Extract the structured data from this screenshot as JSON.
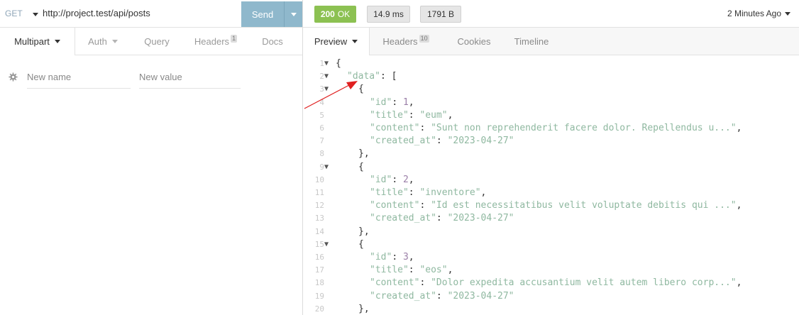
{
  "request": {
    "method": "GET",
    "url": "http://project.test/api/posts",
    "send_label": "Send",
    "tabs": [
      {
        "label": "Multipart",
        "active": true
      },
      {
        "label": "Auth"
      },
      {
        "label": "Query"
      },
      {
        "label": "Headers",
        "badge": "1"
      },
      {
        "label": "Docs"
      }
    ],
    "params": {
      "name_placeholder": "New name",
      "value_placeholder": "New value"
    }
  },
  "response": {
    "status_code": "200",
    "status_text": "OK",
    "time": "14.9 ms",
    "size": "1791 B",
    "history": "2 Minutes Ago",
    "tabs": [
      {
        "label": "Preview",
        "active": true
      },
      {
        "label": "Headers",
        "badge": "10"
      },
      {
        "label": "Cookies"
      },
      {
        "label": "Timeline"
      }
    ],
    "code_lines": [
      {
        "n": "1",
        "fold": true,
        "indent": 0,
        "html": "<span class='p'>{</span>"
      },
      {
        "n": "2",
        "fold": true,
        "indent": 1,
        "html": "<span class='k'>\"data\"</span><span class='p'>: [</span>"
      },
      {
        "n": "3",
        "fold": true,
        "indent": 2,
        "html": "<span class='p'>{</span>"
      },
      {
        "n": "4",
        "fold": false,
        "indent": 3,
        "html": "<span class='k'>\"id\"</span><span class='p'>: </span><span class='n'>1</span><span class='p'>,</span>"
      },
      {
        "n": "5",
        "fold": false,
        "indent": 3,
        "html": "<span class='k'>\"title\"</span><span class='p'>: </span><span class='s'>\"eum\"</span><span class='p'>,</span>"
      },
      {
        "n": "6",
        "fold": false,
        "indent": 3,
        "html": "<span class='k'>\"content\"</span><span class='p'>: </span><span class='s'>\"Sunt non reprehenderit facere dolor. Repellendus u...\"</span><span class='p'>,</span>"
      },
      {
        "n": "7",
        "fold": false,
        "indent": 3,
        "html": "<span class='k'>\"created_at\"</span><span class='p'>: </span><span class='s'>\"2023-04-27\"</span>"
      },
      {
        "n": "8",
        "fold": false,
        "indent": 2,
        "html": "<span class='p'>},</span>"
      },
      {
        "n": "9",
        "fold": true,
        "indent": 2,
        "html": "<span class='p'>{</span>"
      },
      {
        "n": "10",
        "fold": false,
        "indent": 3,
        "html": "<span class='k'>\"id\"</span><span class='p'>: </span><span class='n'>2</span><span class='p'>,</span>"
      },
      {
        "n": "11",
        "fold": false,
        "indent": 3,
        "html": "<span class='k'>\"title\"</span><span class='p'>: </span><span class='s'>\"inventore\"</span><span class='p'>,</span>"
      },
      {
        "n": "12",
        "fold": false,
        "indent": 3,
        "html": "<span class='k'>\"content\"</span><span class='p'>: </span><span class='s'>\"Id est necessitatibus velit voluptate debitis qui ...\"</span><span class='p'>,</span>"
      },
      {
        "n": "13",
        "fold": false,
        "indent": 3,
        "html": "<span class='k'>\"created_at\"</span><span class='p'>: </span><span class='s'>\"2023-04-27\"</span>"
      },
      {
        "n": "14",
        "fold": false,
        "indent": 2,
        "html": "<span class='p'>},</span>"
      },
      {
        "n": "15",
        "fold": true,
        "indent": 2,
        "html": "<span class='p'>{</span>"
      },
      {
        "n": "16",
        "fold": false,
        "indent": 3,
        "html": "<span class='k'>\"id\"</span><span class='p'>: </span><span class='n'>3</span><span class='p'>,</span>"
      },
      {
        "n": "17",
        "fold": false,
        "indent": 3,
        "html": "<span class='k'>\"title\"</span><span class='p'>: </span><span class='s'>\"eos\"</span><span class='p'>,</span>"
      },
      {
        "n": "18",
        "fold": false,
        "indent": 3,
        "html": "<span class='k'>\"content\"</span><span class='p'>: </span><span class='s'>\"Dolor expedita accusantium velit autem libero corp...\"</span><span class='p'>,</span>"
      },
      {
        "n": "19",
        "fold": false,
        "indent": 3,
        "html": "<span class='k'>\"created_at\"</span><span class='p'>: </span><span class='s'>\"2023-04-27\"</span>"
      },
      {
        "n": "20",
        "fold": false,
        "indent": 2,
        "html": "<span class='p'>},</span>"
      }
    ]
  },
  "colors": {
    "send_button": "#8fb8cc",
    "status_ok": "#8cc152",
    "annotation_arrow": "#e02020",
    "json_key": "#8fb8a0",
    "json_number": "#9b7fa8"
  },
  "icons": {
    "params_gear": "gear-icon",
    "fold_marker": "fold-triangle-icon",
    "dropdown": "chevron-down-icon"
  }
}
